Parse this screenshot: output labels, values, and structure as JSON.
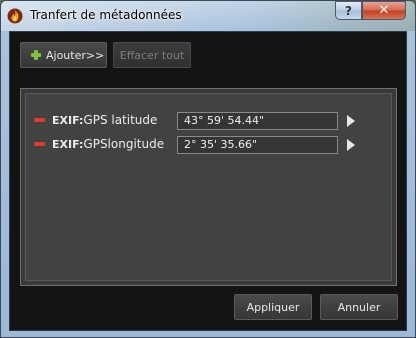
{
  "window": {
    "title": "Tranfert de métadonnées",
    "help_label": "?",
    "close_label": "✕"
  },
  "toolbar": {
    "add_label": "Ajouter>>",
    "clear_label": "Effacer tout"
  },
  "fields": [
    {
      "prefix": "EXIF:",
      "name": "GPS latitude",
      "value": "43° 59' 54.44\""
    },
    {
      "prefix": "EXIF:",
      "name": "GPSlongitude",
      "value": "2° 35' 35.66\""
    }
  ],
  "footer": {
    "apply_label": "Appliquer",
    "cancel_label": "Annuler"
  },
  "colors": {
    "accent_add": "#7ec43a",
    "accent_remove": "#e23a2c",
    "panel_bg": "#424242"
  }
}
